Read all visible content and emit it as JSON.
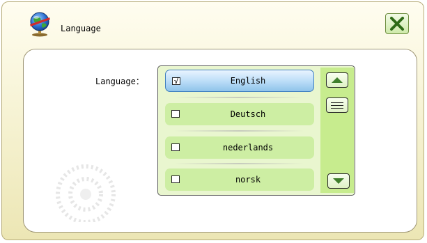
{
  "window": {
    "title": "Language",
    "logo_icon": "globe-icon",
    "close_icon": "close-x-icon"
  },
  "panel": {
    "language_label": "Language："
  },
  "language_list": {
    "items": [
      {
        "label": "English",
        "checked": true
      },
      {
        "label": "Deutsch",
        "checked": false
      },
      {
        "label": "nederlands",
        "checked": false
      },
      {
        "label": "norsk",
        "checked": false
      }
    ],
    "check_mark": "√"
  },
  "scrollbar": {
    "up_icon": "triangle-up-icon",
    "down_icon": "triangle-down-icon",
    "thumb_icon": "grip-lines-icon"
  },
  "colors": {
    "title_gradient": "#f4f0cc",
    "item_bg": "#cdeea3",
    "selected_item": "#b9dcf7",
    "scroll_track": "#c7ec8e",
    "arrow_fill": "#3f7f2b",
    "close_x": "#2f6b17"
  }
}
